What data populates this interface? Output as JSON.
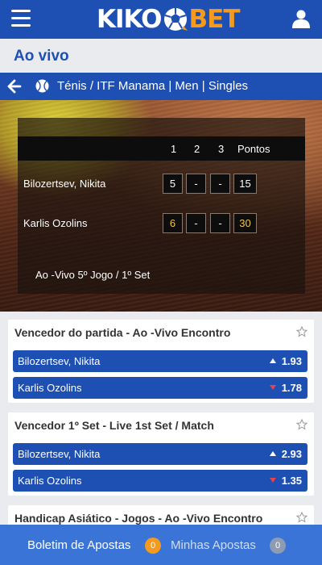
{
  "header": {
    "logo_left": "KIKO",
    "logo_right": "BET",
    "menu_icon": "hamburger-menu-icon",
    "user_icon": "user-icon"
  },
  "page": {
    "title": "Ao vivo"
  },
  "breadcrumb": {
    "text": "Ténis / ITF Manama | Men | Singles"
  },
  "scoreboard": {
    "columns": [
      "1",
      "2",
      "3",
      "Pontos"
    ],
    "players": [
      {
        "name": "Bilozertsev, Nikita",
        "sets": [
          "5",
          "-",
          "-"
        ],
        "points": "15"
      },
      {
        "name": "Karlis Ozolins",
        "sets": [
          "6",
          "-",
          "-"
        ],
        "points": "30"
      }
    ],
    "status": "Ao -Vivo 5º Jogo / 1º Set"
  },
  "markets": [
    {
      "title": "Vencedor do partida - Ao -Vivo Encontro",
      "outcomes": [
        {
          "name": "Bilozertsev, Nikita",
          "odd": "1.93",
          "trend": "up"
        },
        {
          "name": "Karlis Ozolins",
          "odd": "1.78",
          "trend": "down"
        }
      ]
    },
    {
      "title": "Vencedor 1º Set - Live 1st Set / Match",
      "outcomes": [
        {
          "name": "Bilozertsev, Nikita",
          "odd": "2.93",
          "trend": "up"
        },
        {
          "name": "Karlis Ozolins",
          "odd": "1.35",
          "trend": "down"
        }
      ]
    },
    {
      "title": "Handicap Asiático - Jogos - Ao -Vivo Encontro",
      "outcomes": []
    }
  ],
  "bottom_bar": {
    "betslip_label": "Boletim de Apostas",
    "betslip_count": "0",
    "mybets_label": "Minhas Apostas",
    "mybets_count": "0"
  },
  "colors": {
    "primary": "#1e50b4",
    "accent": "#f39a1f",
    "bottom_bar": "#3a74d6",
    "up_arrow": "#ffffff",
    "down_arrow": "#e8424b"
  }
}
